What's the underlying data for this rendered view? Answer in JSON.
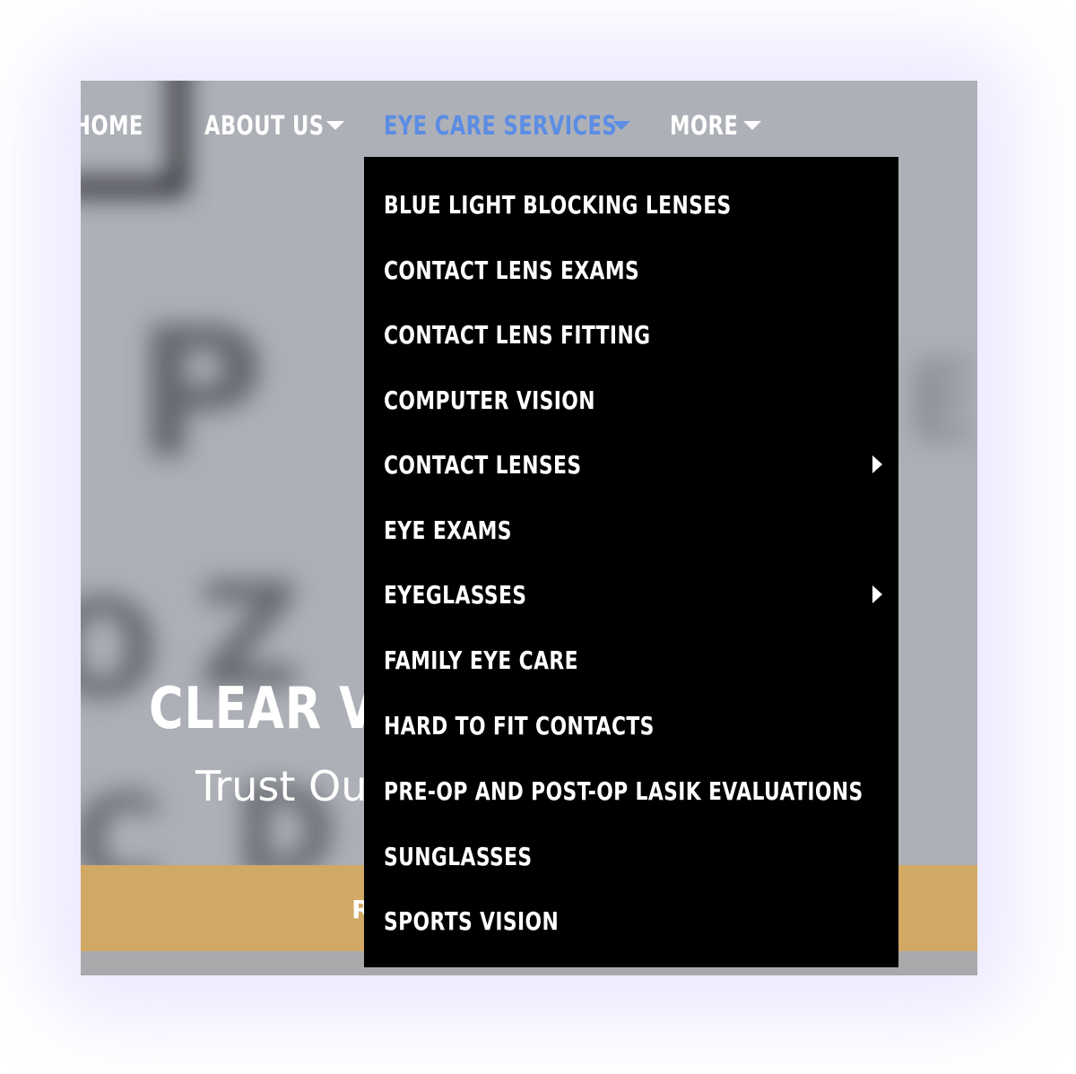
{
  "nav": {
    "items": [
      {
        "label": "HOME",
        "has_caret": false,
        "active": false
      },
      {
        "label": "ABOUT US",
        "has_caret": true,
        "active": false
      },
      {
        "label": "EYE CARE SERVICES",
        "has_caret": true,
        "active": true
      },
      {
        "label": "MORE",
        "has_caret": true,
        "active": false
      }
    ],
    "active_color": "#5b8de4"
  },
  "dropdown": {
    "items": [
      {
        "label": "BLUE LIGHT BLOCKING LENSES",
        "has_submenu": false
      },
      {
        "label": "CONTACT LENS EXAMS",
        "has_submenu": false
      },
      {
        "label": "CONTACT LENS FITTING",
        "has_submenu": false
      },
      {
        "label": "COMPUTER VISION",
        "has_submenu": false
      },
      {
        "label": "CONTACT LENSES",
        "has_submenu": true,
        "arrow_icon": "chevron-right-icon"
      },
      {
        "label": "EYE EXAMS",
        "has_submenu": false
      },
      {
        "label": "EYEGLASSES",
        "has_submenu": true,
        "arrow_icon": "chevron-right-icon"
      },
      {
        "label": "FAMILY EYE CARE",
        "has_submenu": false
      },
      {
        "label": "HARD TO FIT CONTACTS",
        "has_submenu": false
      },
      {
        "label": "PRE-OP AND POST-OP LASIK EVALUATIONS",
        "has_submenu": false
      },
      {
        "label": "SUNGLASSES",
        "has_submenu": false
      },
      {
        "label": "SPORTS VISION",
        "has_submenu": false
      }
    ]
  },
  "hero": {
    "title_visible": "CLEAR VI",
    "subtitle_visible": "Trust Ou",
    "band_letter": "R"
  },
  "colors": {
    "background": "#aeb0b8",
    "dropdown_bg": "#000000",
    "cta_band": "#d1a964",
    "text": "#ffffff"
  }
}
